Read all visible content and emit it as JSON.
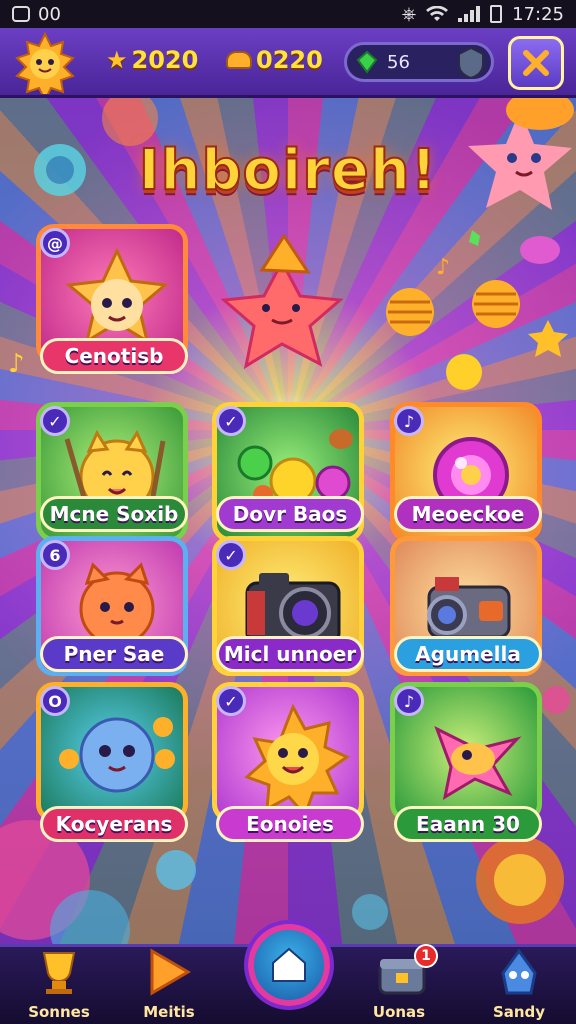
{
  "status_bar": {
    "left_text": "00",
    "time": "17:25"
  },
  "top_bar": {
    "stars": "2020",
    "coins": "0220",
    "gems": "56"
  },
  "title": "Ihboireh!",
  "cards": [
    {
      "label": "Cenotisb",
      "badge": "@",
      "label_color": "#e8366a"
    },
    {
      "label": "Mcne Soxib",
      "badge": "✓",
      "label_color": "#2a8a3a"
    },
    {
      "label": "Dovr Baos",
      "badge": "✓",
      "label_color": "#a03ad0"
    },
    {
      "label": "Meoeckoe",
      "badge": "♪",
      "label_color": "#b030c0"
    },
    {
      "label": "Pner Sae",
      "badge": "6",
      "label_color": "#5a3ac8"
    },
    {
      "label": "Micl unnoer",
      "badge": "✓",
      "label_color": "#8a2ac8"
    },
    {
      "label": "Agumella",
      "badge": "",
      "label_color": "#2aa0e0"
    },
    {
      "label": "Kocyerans",
      "badge": "O",
      "label_color": "#e0306a"
    },
    {
      "label": "Eonoies",
      "badge": "✓",
      "label_color": "#c83ad0"
    },
    {
      "label": "Eaann 30",
      "badge": "♪",
      "label_color": "#2a9a3a"
    }
  ],
  "bottom_nav": [
    {
      "label": "Sonnes",
      "icon": "trophy-icon"
    },
    {
      "label": "Meitis",
      "icon": "play-icon"
    },
    {
      "label": "",
      "icon": "home-icon"
    },
    {
      "label": "Uonas",
      "icon": "chest-icon",
      "notification": "1"
    },
    {
      "label": "Sandy",
      "icon": "mascot-icon"
    }
  ],
  "colors": {
    "title_fill": "#ffd43a",
    "accent_purple": "#6b3fc4",
    "frame_gold": "#ffd23a"
  }
}
